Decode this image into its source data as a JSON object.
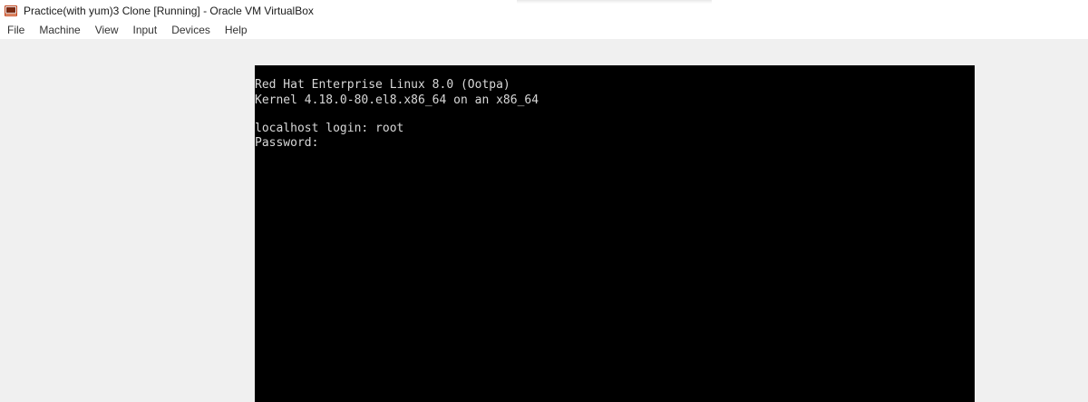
{
  "window": {
    "title": "Practice(with yum)3 Clone [Running] - Oracle VM VirtualBox",
    "icon": "virtualbox-app-icon"
  },
  "menu": {
    "items": [
      "File",
      "Machine",
      "View",
      "Input",
      "Devices",
      "Help"
    ]
  },
  "console": {
    "lines": [
      "Red Hat Enterprise Linux 8.0 (Ootpa)",
      "Kernel 4.18.0-80.el8.x86_64 on an x86_64",
      "",
      "localhost login: root",
      "Password:"
    ]
  },
  "colors": {
    "screen_bg": "#000000",
    "console_text": "#d8d8d8",
    "window_bg": "#f0f0f0"
  }
}
